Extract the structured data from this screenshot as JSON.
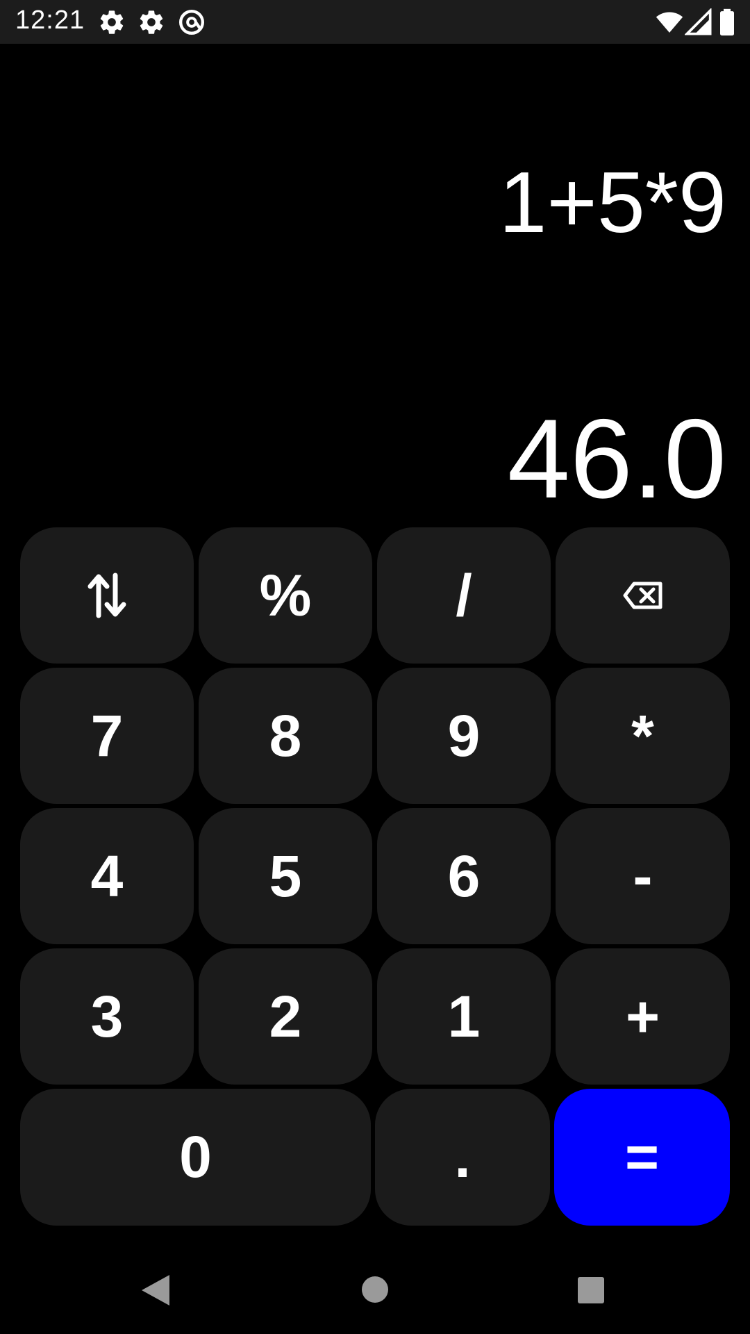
{
  "status_bar": {
    "time": "12:21",
    "left_icons": [
      "gear-icon",
      "gear-icon",
      "at-sign-icon"
    ],
    "right_icons": [
      "wifi-icon",
      "signal-icon",
      "battery-icon"
    ]
  },
  "display": {
    "expression": "1+5*9",
    "result": "46.0"
  },
  "keypad": {
    "row1": {
      "swap_icon": "swap-vertical-icon",
      "percent": "%",
      "divide": "/",
      "backspace_icon": "backspace-icon"
    },
    "row2": {
      "seven": "7",
      "eight": "8",
      "nine": "9",
      "multiply": "*"
    },
    "row3": {
      "four": "4",
      "five": "5",
      "six": "6",
      "minus": "-"
    },
    "row4": {
      "three": "3",
      "two": "2",
      "one": "1",
      "plus": "+"
    },
    "row5": {
      "zero": "0",
      "dot": ".",
      "equals": "="
    }
  },
  "colors": {
    "background": "#000000",
    "key": "#1b1b1b",
    "equals_key": "#0000ff",
    "text": "#ffffff",
    "status_bar": "#1c1c1c"
  },
  "nav_bar": {
    "icons": [
      "back-triangle-icon",
      "home-circle-icon",
      "recents-square-icon"
    ]
  }
}
